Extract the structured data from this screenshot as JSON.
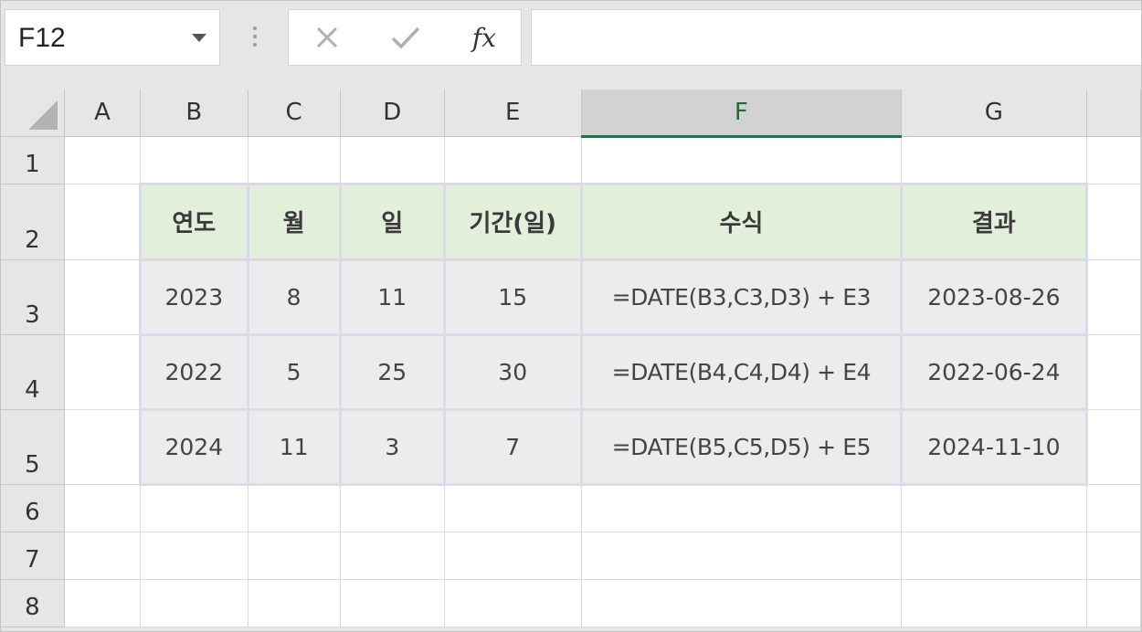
{
  "formula_bar": {
    "name_box": "F12",
    "cancel_icon": "close-icon",
    "enter_icon": "check-icon",
    "function_label": "fx",
    "formula_value": ""
  },
  "columns": [
    "A",
    "B",
    "C",
    "D",
    "E",
    "F",
    "G"
  ],
  "selected_column": "F",
  "rows": [
    "1",
    "2",
    "3",
    "4",
    "5",
    "6",
    "7",
    "8"
  ],
  "table": {
    "headers": [
      "연도",
      "월",
      "일",
      "기간(일)",
      "수식",
      "결과"
    ],
    "rows": [
      [
        "2023",
        "8",
        "11",
        "15",
        "=DATE(B3,C3,D3) + E3",
        "2023-08-26"
      ],
      [
        "2022",
        "5",
        "25",
        "30",
        "=DATE(B4,C4,D4) + E4",
        "2022-06-24"
      ],
      [
        "2024",
        "11",
        "3",
        "7",
        "=DATE(B5,C5,D5) + E5",
        "2024-11-10"
      ]
    ]
  },
  "colors": {
    "header_fill": "#e2efda",
    "data_fill": "#ececec",
    "selection_accent": "#217346"
  }
}
